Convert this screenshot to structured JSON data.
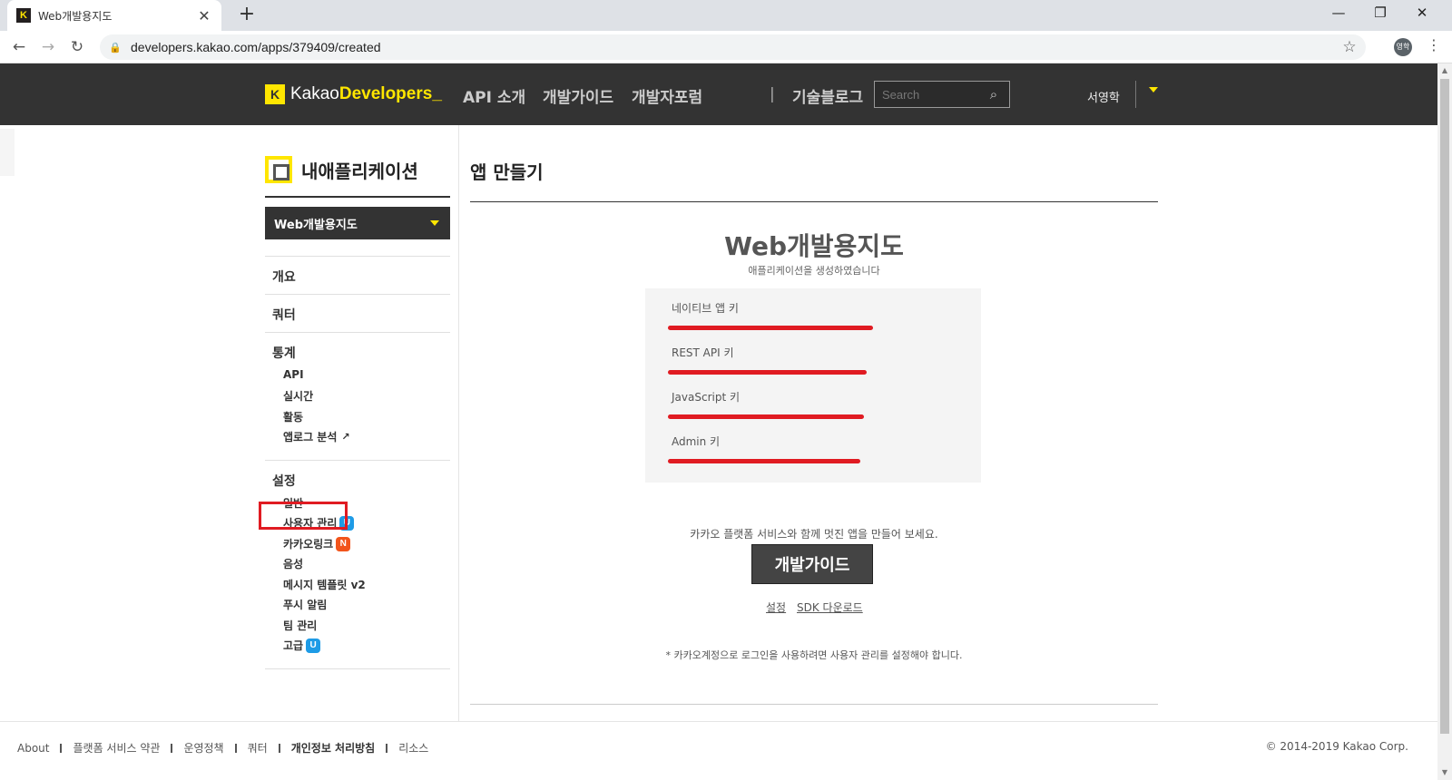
{
  "browser": {
    "tab_title": "Web개발용지도",
    "favicon_letter": "K",
    "new_tab": "+",
    "url": "developers.kakao.com/apps/379409/created",
    "profile": "영학"
  },
  "gnb": {
    "logo_plain": "Kakao",
    "logo_bold": "Developers_",
    "links": [
      "API 소개",
      "개발가이드",
      "개발자포럼"
    ],
    "sep": "|",
    "blog": "기술블로그",
    "search_placeholder": "Search",
    "user_name": "서영학"
  },
  "lnb": {
    "title": "내애플리케이션",
    "selected_app": "Web개발용지도",
    "overview": "개요",
    "quota": "쿼터",
    "stats": {
      "label": "통계",
      "items": [
        "API",
        "실시간",
        "활동",
        "앱로그 분석"
      ]
    },
    "settings": {
      "label": "설정",
      "items": [
        "일반",
        "사용자 관리",
        "카카오링크",
        "음성",
        "메시지 템플릿 v2",
        "푸시 알림",
        "팀 관리",
        "고급"
      ],
      "badges": {
        "user": "U",
        "link": "N",
        "advanced": "U"
      }
    }
  },
  "main": {
    "title": "앱 만들기",
    "app_name": "Web개발용지도",
    "created_msg": "애플리케이션을 생성하였습니다",
    "keys": [
      {
        "label": "네이티브 앱 키"
      },
      {
        "label": "REST API 키"
      },
      {
        "label": "JavaScript 키"
      },
      {
        "label": "Admin 키"
      }
    ],
    "promo": "카카오 플랫폼 서비스와 함께 멋진 앱을 만들어 보세요.",
    "guide_button": "개발가이드",
    "link_settings": "설정",
    "link_sdk": "SDK 다운로드",
    "note": "* 카카오계정으로 로그인을 사용하려면 사용자 관리를 설정해야 합니다."
  },
  "footer": {
    "links": [
      "About",
      "플랫폼 서비스 약관",
      "운영정책",
      "쿼터",
      "개인정보 처리방침",
      "리소스"
    ],
    "copyright": "© 2014-2019 Kakao Corp."
  },
  "colors": {
    "accent": "#ffe600",
    "gnb_bg": "#333333",
    "redaction": "#e01b22",
    "badge_u": "#1e9be6",
    "badge_n": "#f2541b"
  }
}
